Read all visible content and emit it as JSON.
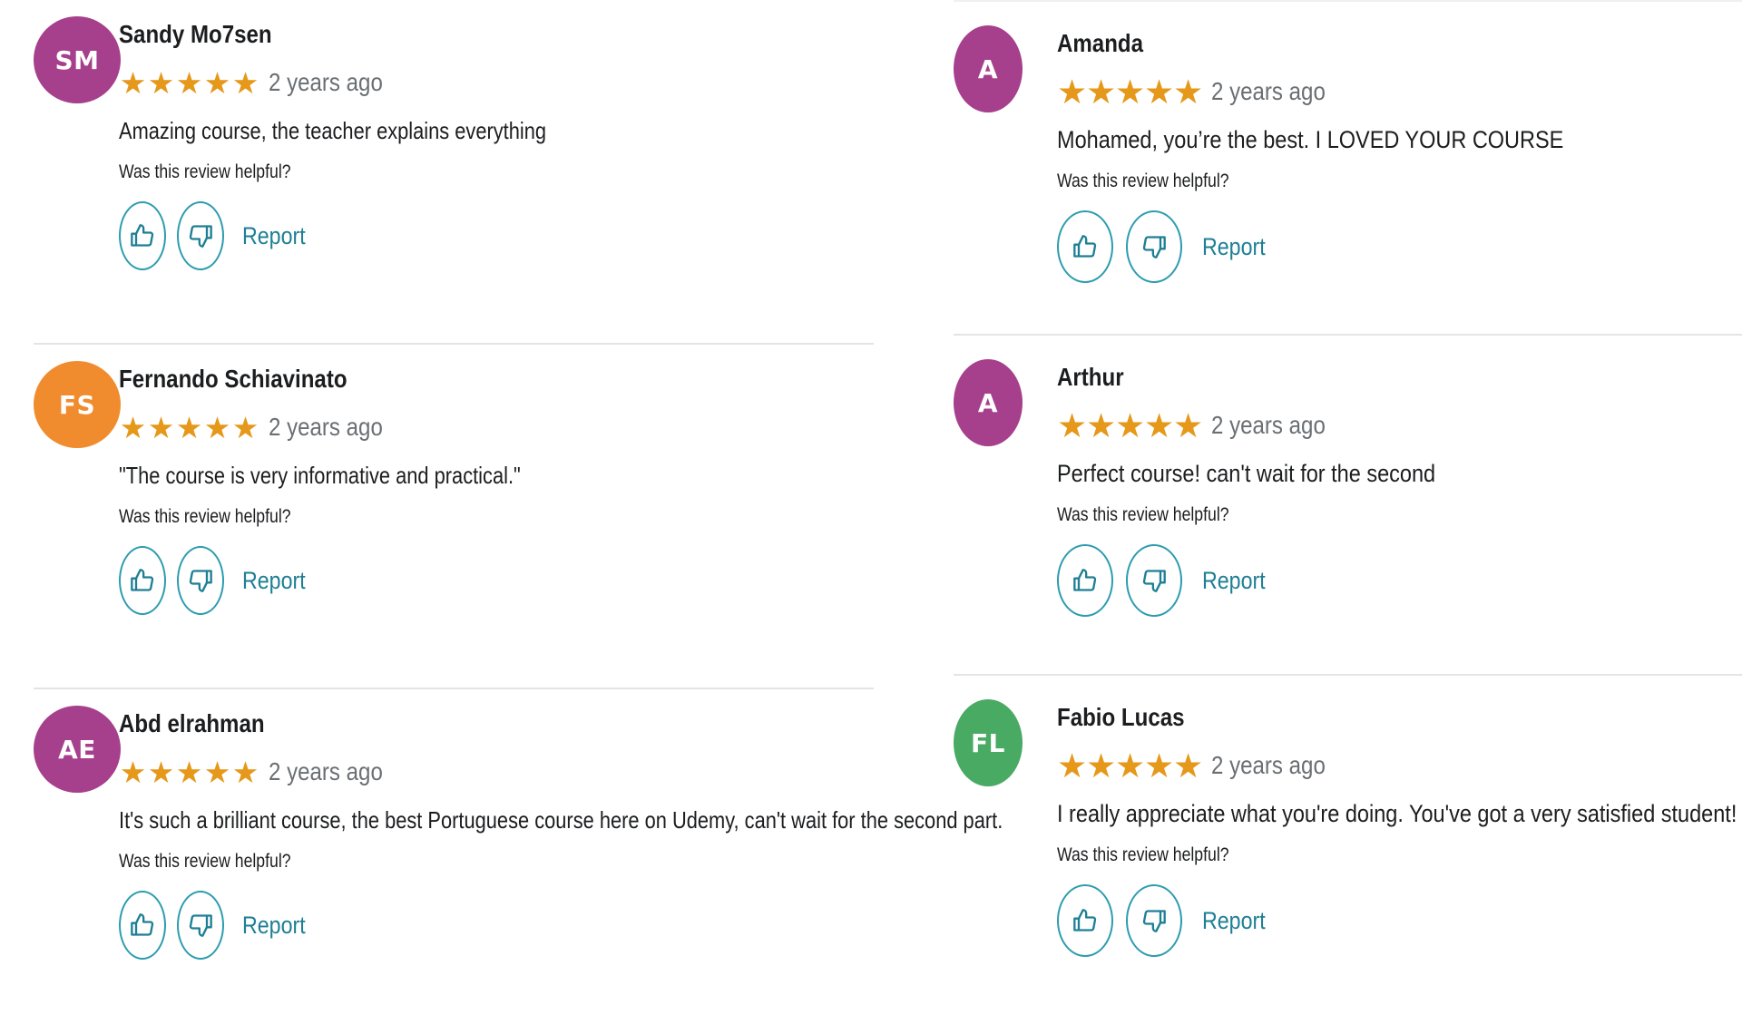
{
  "colors": {
    "star": "#e59819",
    "accent": "#2d9caf",
    "link": "#1e7f94",
    "avatar_purple": "#a63f8c",
    "avatar_orange": "#f08c2e",
    "avatar_green": "#49aa63"
  },
  "icons": {
    "star": "star-icon",
    "thumbs_up": "thumbs-up-icon",
    "thumbs_down": "thumbs-down-icon"
  },
  "common": {
    "helpful_prompt": "Was this review helpful?",
    "report_label": "Report",
    "rating": 5
  },
  "left_column": [
    {
      "initials": "SM",
      "avatar_color": "#a63f8c",
      "name": "Sandy Mo7sen",
      "time": "2 years ago",
      "comment": "Amazing course, the teacher explains everything"
    },
    {
      "initials": "FS",
      "avatar_color": "#f08c2e",
      "name": "Fernando Schiavinato",
      "time": "2 years ago",
      "comment": "\"The course is very informative and practical.\""
    },
    {
      "initials": "AE",
      "avatar_color": "#a63f8c",
      "name": "Abd elrahman",
      "time": "2 years ago",
      "comment": "It's such a brilliant course, the best Portuguese course here on Udemy, can't wait for the second part."
    }
  ],
  "right_column": [
    {
      "initials": "A",
      "avatar_color": "#a63f8c",
      "name": "Amanda",
      "time": "2 years ago",
      "comment": "Mohamed, you’re the best. I LOVED YOUR COURSE"
    },
    {
      "initials": "A",
      "avatar_color": "#a63f8c",
      "name": "Arthur",
      "time": "2 years ago",
      "comment": "Perfect course! can't wait for the second"
    },
    {
      "initials": "FL",
      "avatar_color": "#49aa63",
      "name": "Fabio Lucas",
      "time": "2 years ago",
      "comment": "I really appreciate what you're doing. You've got a very satisfied student!"
    }
  ]
}
